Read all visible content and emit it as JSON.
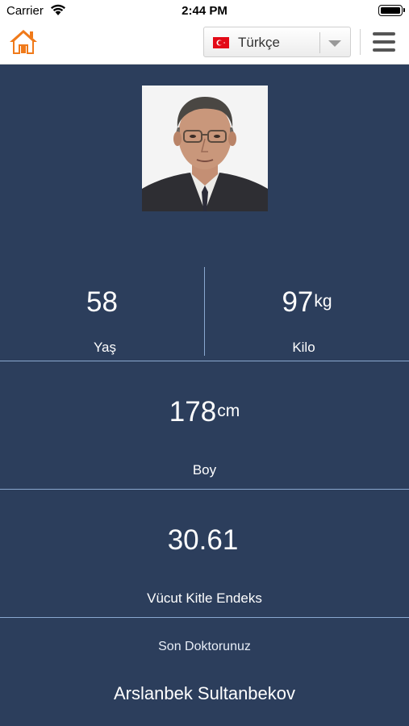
{
  "status_bar": {
    "carrier": "Carrier",
    "time": "2:44 PM"
  },
  "nav": {
    "home_icon": "home-icon",
    "language": "Türkçe",
    "language_flag": "turkey-flag-icon",
    "menu_icon": "hamburger-menu-icon",
    "accent_color": "#f07a1a"
  },
  "profile": {
    "photo_alt": "profile-photo",
    "age": {
      "value": "58",
      "unit": "",
      "label": "Yaş"
    },
    "weight": {
      "value": "97",
      "unit": "kg",
      "label": "Kilo"
    },
    "height": {
      "value": "178",
      "unit": "cm",
      "label": "Boy"
    },
    "bmi": {
      "value": "30.61",
      "label": "Vücut Kitle Endeks"
    },
    "doctor": {
      "label": "Son Doktorunuz",
      "name": "Arslanbek Sultanbekov"
    }
  },
  "colors": {
    "background": "#2c3e5c",
    "divider": "#8aa8cf",
    "text": "#ffffff"
  }
}
